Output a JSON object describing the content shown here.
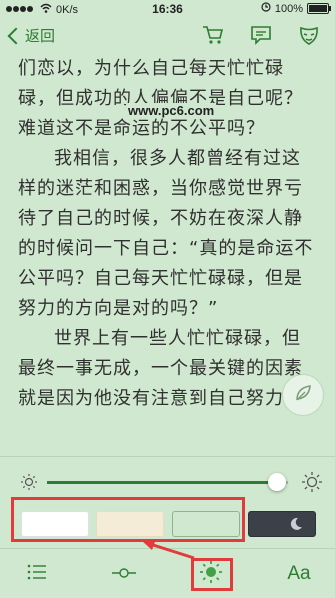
{
  "status_bar": {
    "speed": "0K/s",
    "time": "16:36",
    "battery": "100%"
  },
  "nav": {
    "back_label": "返回",
    "icons": [
      "cart-icon",
      "comment-icon",
      "mask-icon"
    ]
  },
  "reader": {
    "paragraphs": [
      "们恋以，为什么自己每天忙忙碌碌，但成功的人偏偏不是自己呢？难道这不是命运的不公平吗？",
      "我相信，很多人都曾经有过这样的迷茫和困惑，当你感觉世界亏待了自己的时候，不妨在夜深人静的时候问一下自己：“真的是命运不公平吗？自己每天忙忙碌碌，但是努力的方向是对的吗？”",
      "世界上有一些人忙忙碌碌，但最终一事无成，一个最关键的因素就是因为他没有注意到自己努力的方向是否正确，结果很可能把精力消耗在了偏离自己重要的事情上，自自做了许多无"
    ],
    "watermark": "www.pc6.com"
  },
  "brightness": {
    "level": 0.97
  },
  "themes": [
    {
      "name": "white",
      "color": "#ffffff"
    },
    {
      "name": "sepia",
      "color": "#f5ecd8"
    },
    {
      "name": "green",
      "color": "#cfe8cf"
    },
    {
      "name": "night",
      "color": "#3b4049"
    }
  ],
  "toolbar": {
    "font_label": "Aa"
  },
  "colors": {
    "accent": "#2e7d32",
    "highlight": "#e23b3b",
    "background": "#cfe8cf"
  }
}
